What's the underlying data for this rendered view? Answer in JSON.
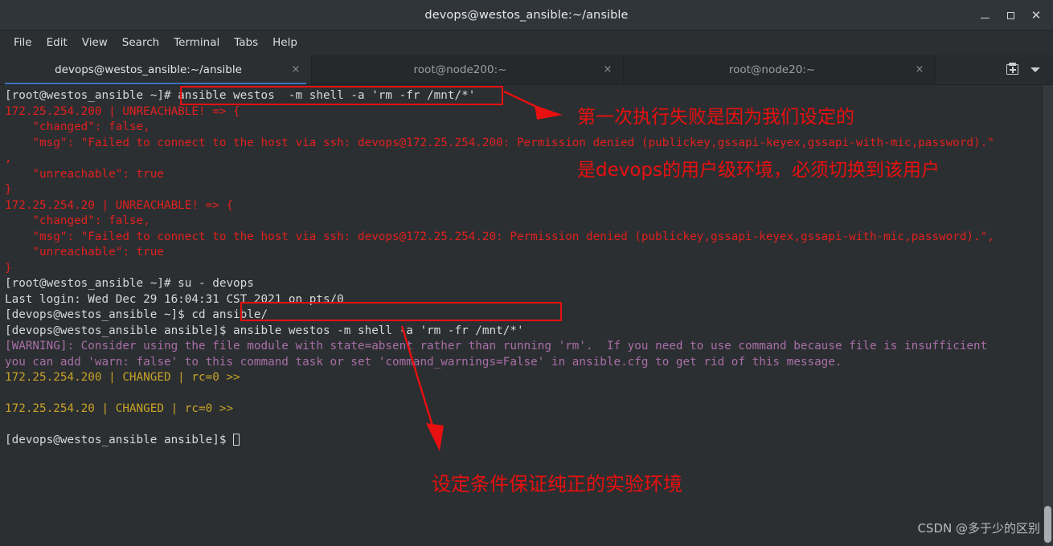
{
  "window": {
    "title": "devops@westos_ansible:~/ansible",
    "minimize_label": "Minimize",
    "maximize_label": "Maximize",
    "close_label": "Close"
  },
  "menubar": {
    "items": [
      {
        "label": "File"
      },
      {
        "label": "Edit"
      },
      {
        "label": "View"
      },
      {
        "label": "Search"
      },
      {
        "label": "Terminal"
      },
      {
        "label": "Tabs"
      },
      {
        "label": "Help"
      }
    ]
  },
  "tabbar": {
    "tabs": [
      {
        "label": "devops@westos_ansible:~/ansible",
        "close": "×",
        "active": true
      },
      {
        "label": "root@node200:~",
        "close": "×",
        "active": false
      },
      {
        "label": "root@node20:~",
        "close": "×",
        "active": false
      }
    ],
    "new_tab_icon": "new-tab-icon",
    "tab_menu_icon": "chevron-down-icon"
  },
  "terminal": {
    "lines": [
      {
        "id": "l01",
        "text": "[root@westos_ansible ~]# ansible westos  -m shell -a 'rm -fr /mnt/*'",
        "color": "white"
      },
      {
        "id": "l02",
        "text": "172.25.254.200 | UNREACHABLE! => {",
        "color": "red"
      },
      {
        "id": "l03",
        "text": "    \"changed\": false,",
        "color": "red"
      },
      {
        "id": "l04",
        "text": "    \"msg\": \"Failed to connect to the host via ssh: devops@172.25.254.200: Permission denied (publickey,gssapi-keyex,gssapi-with-mic,password).\"",
        "color": "red"
      },
      {
        "id": "l05",
        "text": ",",
        "color": "red"
      },
      {
        "id": "l06",
        "text": "    \"unreachable\": true",
        "color": "red"
      },
      {
        "id": "l07",
        "text": "}",
        "color": "red"
      },
      {
        "id": "l08",
        "text": "172.25.254.20 | UNREACHABLE! => {",
        "color": "red"
      },
      {
        "id": "l09",
        "text": "    \"changed\": false,",
        "color": "red"
      },
      {
        "id": "l10",
        "text": "    \"msg\": \"Failed to connect to the host via ssh: devops@172.25.254.20: Permission denied (publickey,gssapi-keyex,gssapi-with-mic,password).\",",
        "color": "red"
      },
      {
        "id": "l11",
        "text": "    \"unreachable\": true",
        "color": "red"
      },
      {
        "id": "l12",
        "text": "}",
        "color": "red"
      },
      {
        "id": "l13",
        "text": "[root@westos_ansible ~]# su - devops",
        "color": "white"
      },
      {
        "id": "l14",
        "text": "Last login: Wed Dec 29 16:04:31 CST 2021 on pts/0",
        "color": "white"
      },
      {
        "id": "l15",
        "text": "[devops@westos_ansible ~]$ cd ansible/",
        "color": "white"
      },
      {
        "id": "l16",
        "text": "[devops@westos_ansible ansible]$ ansible westos -m shell -a 'rm -fr /mnt/*'",
        "color": "white"
      },
      {
        "id": "l17",
        "text": "[WARNING]: Consider using the file module with state=absent rather than running 'rm'.  If you need to use command because file is insufficient",
        "color": "purple"
      },
      {
        "id": "l18",
        "text": "you can add 'warn: false' to this command task or set 'command_warnings=False' in ansible.cfg to get rid of this message.",
        "color": "purple"
      },
      {
        "id": "l19",
        "text": "172.25.254.200 | CHANGED | rc=0 >>",
        "color": "yellow"
      },
      {
        "id": "l20",
        "text": "",
        "color": "white"
      },
      {
        "id": "l21",
        "text": "172.25.254.20 | CHANGED | rc=0 >>",
        "color": "yellow"
      },
      {
        "id": "l22",
        "text": "",
        "color": "white"
      },
      {
        "id": "l23",
        "text": "[devops@westos_ansible ansible]$ ",
        "color": "white",
        "cursor": true
      }
    ]
  },
  "annotations": {
    "note1": "第一次执行失败是因为我们设定的",
    "note2": "是devops的用户级环境，必须切换到该用户",
    "note3": "设定条件保证纯正的实验环境"
  },
  "colors": {
    "annotation_red": "#e81010",
    "terminal_red": "#e02020",
    "terminal_yellow": "#c9a227",
    "terminal_purple": "#a96ea8",
    "tab_accent": "#3d77c2",
    "terminal_bg": "#2b2f31"
  },
  "watermark": {
    "text": "CSDN @多于少的区别"
  }
}
